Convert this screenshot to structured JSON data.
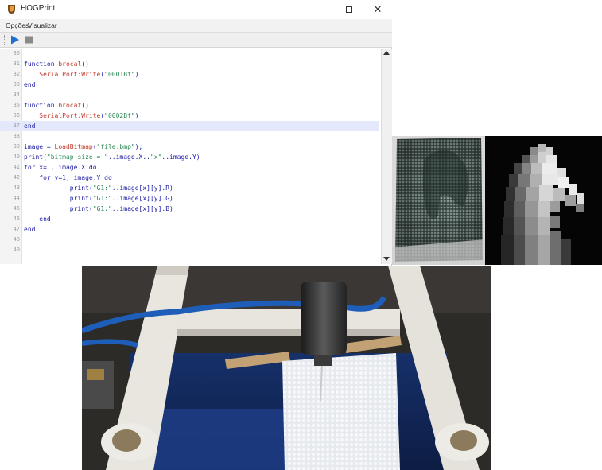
{
  "window": {
    "title": "HOGPrint",
    "icon": "hogprint-app-icon",
    "controls": {
      "minimize": "minimize-icon",
      "maximize": "maximize-icon",
      "close": "close-icon",
      "close_glyph": "✕"
    }
  },
  "menu": [
    "Opções",
    "Visualizar"
  ],
  "toolbar": {
    "buttons": [
      {
        "name": "run",
        "icon": "play-icon",
        "color": "#1f6fd1"
      },
      {
        "name": "stop",
        "icon": "stop-icon",
        "color": "#8a8a8a"
      }
    ]
  },
  "editor": {
    "current_line": 37,
    "lines": [
      {
        "n": "30",
        "text": ""
      },
      {
        "n": "31",
        "text": "function brocal()"
      },
      {
        "n": "32",
        "text": "    SerialPort:Write(\"0001Bf\")"
      },
      {
        "n": "33",
        "text": "end"
      },
      {
        "n": "34",
        "text": ""
      },
      {
        "n": "35",
        "text": "function brocaf()"
      },
      {
        "n": "36",
        "text": "    SerialPort:Write(\"0002Bf\")"
      },
      {
        "n": "37",
        "text": "end"
      },
      {
        "n": "38",
        "text": ""
      },
      {
        "n": "39",
        "text": "image = LoadBitmap(\"file.bmp\");"
      },
      {
        "n": "40",
        "text": "print(\"bitmap size = \"..image.X..\"x\"..image.Y)"
      },
      {
        "n": "41",
        "text": "for x=1, image.X do"
      },
      {
        "n": "42",
        "text": "    for y=1, image.Y do"
      },
      {
        "n": "43",
        "text": "            print(\"G1:\"..image[x][y].R)"
      },
      {
        "n": "44",
        "text": "            print(\"G1:\"..image[x][y].G)"
      },
      {
        "n": "45",
        "text": "            print(\"G1:\"..image[x][y].B)"
      },
      {
        "n": "46",
        "text": "    end"
      },
      {
        "n": "47",
        "text": "end"
      },
      {
        "n": "48",
        "text": ""
      },
      {
        "n": "49",
        "text": ""
      }
    ]
  },
  "colors": {
    "keyword": "#1a1aa6",
    "string": "#2e8b57",
    "function": "#c0392b",
    "line_highlight": "#e3e8fb"
  },
  "images": {
    "carved_result": "carved-foam-horse-photo",
    "bitmap": "grayscale-horse-bitmap",
    "machine": "cnc-foam-carving-machine-photo"
  }
}
